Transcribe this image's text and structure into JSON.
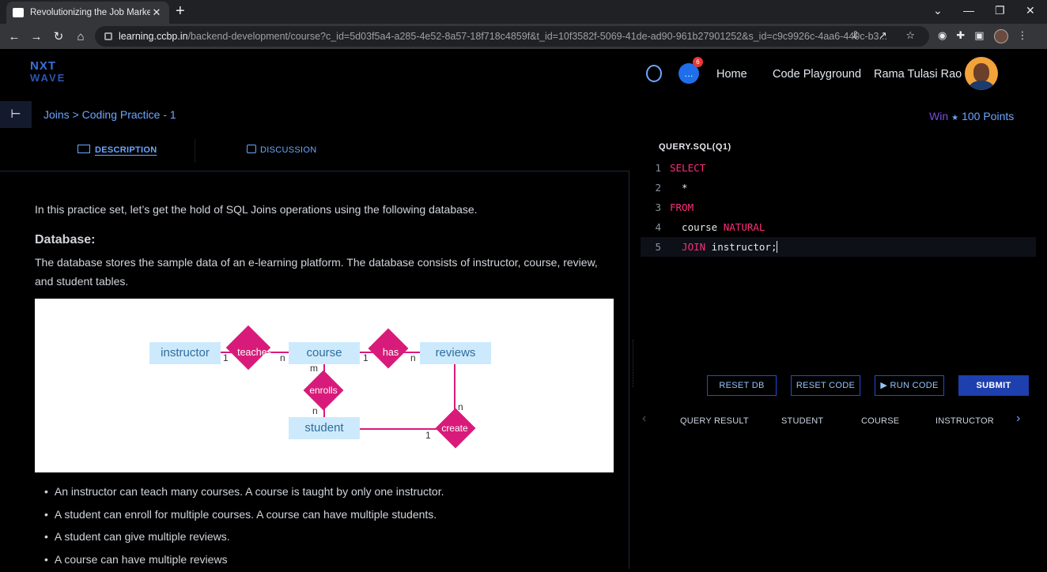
{
  "browser": {
    "tab_title": "Revolutionizing the Job Market |",
    "tab_close": "✕",
    "new_tab": "+",
    "url_host": "learning.ccbp.in",
    "url_rest": "/backend-development/course?c_id=5d03f5a4-a285-4e52-8a57-18f718c4859f&t_id=10f3582f-5069-41de-ad90-961b27901252&s_id=c9c9926c-4aa6-440c-b3..."
  },
  "header": {
    "logo_line1": "NXT",
    "logo_line2": "WAVE",
    "notification_count": "6",
    "nav": [
      "Home",
      "Code Playground"
    ],
    "user_name": "Rama Tulasi Rao"
  },
  "subheader": {
    "breadcrumb": "Joins > Coding Practice - 1",
    "win_label": "Win",
    "points": "100 Points"
  },
  "tabs": {
    "description": "DESCRIPTION",
    "discussion": "DISCUSSION"
  },
  "description": {
    "intro": "In this practice set, let’s get the hold of SQL Joins operations using the following database.",
    "db_heading": "Database:",
    "db_text": "The database stores the sample data of an e-learning platform. The database consists of instructor, course, review, and student tables.",
    "er": {
      "entities": {
        "instructor": "instructor",
        "course": "course",
        "reviews": "reviews",
        "student": "student"
      },
      "relations": {
        "teaches": "teaches",
        "has": "has",
        "enrolls": "enrolls",
        "create": "create"
      },
      "cardinalities": {
        "instructor_teaches": "1",
        "teaches_course": "n",
        "course_has": "1",
        "has_reviews": "n",
        "course_enrolls": "m",
        "enrolls_student": "n",
        "reviews_create": "n",
        "student_create": "1"
      }
    },
    "bullets": [
      "An instructor can teach many courses. A course is taught by only one instructor.",
      "A student can enroll for multiple courses. A course can have multiple students.",
      "A student can give multiple reviews.",
      "A course can have multiple reviews"
    ]
  },
  "editor": {
    "file_name": "QUERY.SQL(Q1)",
    "lines": [
      {
        "n": "1",
        "kw": "SELECT",
        "tx": ""
      },
      {
        "n": "2",
        "kw": "",
        "tx": "  *"
      },
      {
        "n": "3",
        "kw": "FROM",
        "tx": ""
      },
      {
        "n": "4",
        "kw": "",
        "tx": "  course",
        "kw2": "NATURAL"
      },
      {
        "n": "5",
        "kw": "  JOIN",
        "tx": " instructor;"
      }
    ],
    "buttons": {
      "reset_db": "RESET DB",
      "reset_code": "RESET CODE",
      "run_code": "▶ RUN CODE",
      "submit": "SUBMIT"
    },
    "result_tabs": [
      "QUERY RESULT",
      "STUDENT",
      "COURSE",
      "INSTRUCTOR"
    ]
  },
  "colors": {
    "accent_blue": "#6ca6ff",
    "keyword_pink": "#ff2d7a",
    "er_magenta": "#d81b7a",
    "er_entity_bg": "#cdeafd"
  }
}
